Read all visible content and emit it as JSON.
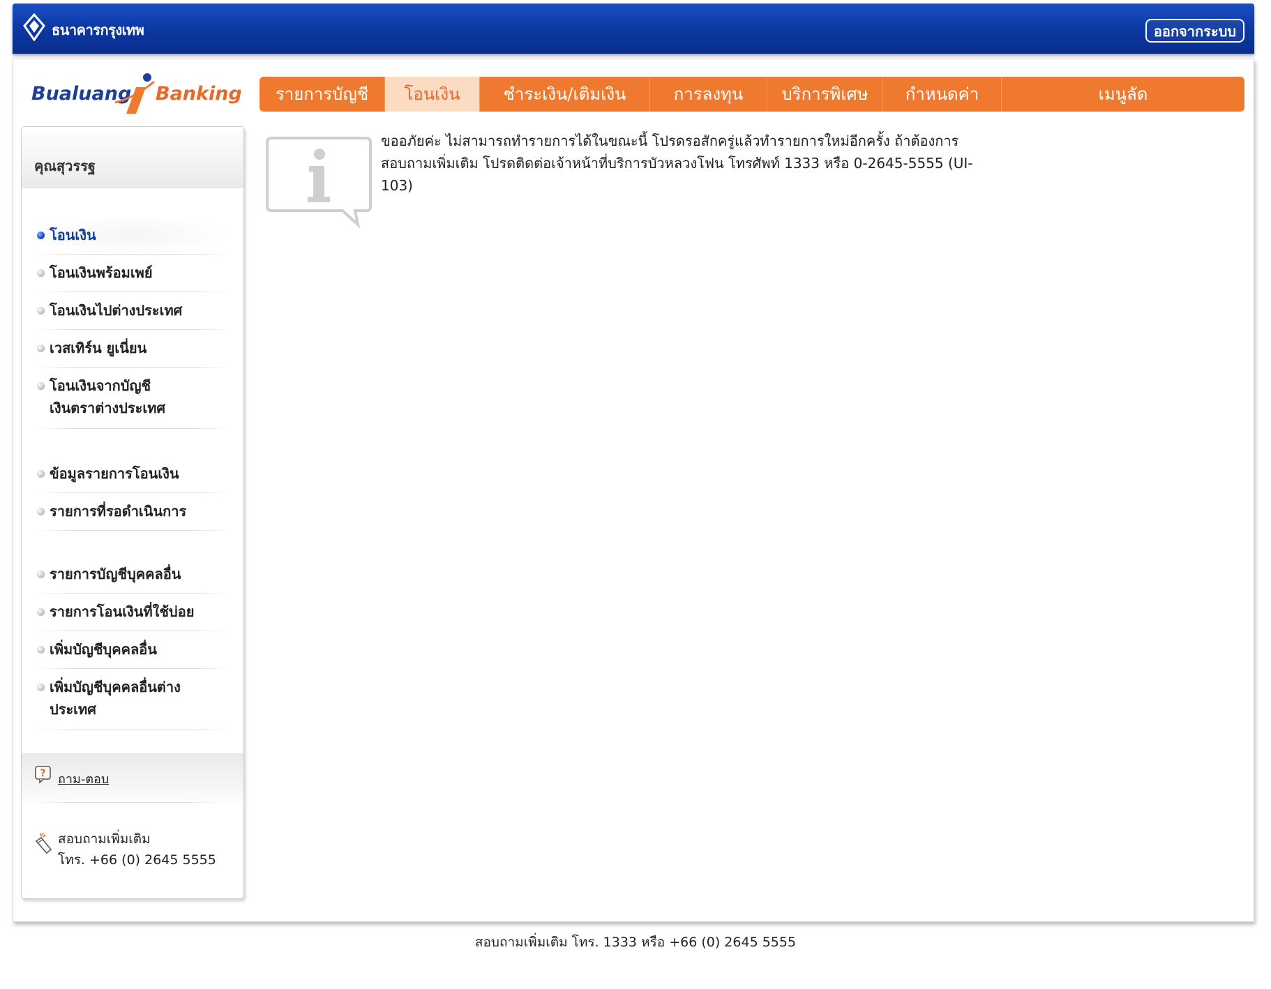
{
  "header": {
    "bank_name": "ธนาคารกรุงเทพ",
    "logout_label": "ออกจากระบบ"
  },
  "brand": {
    "logo_text_left": "Bualuang",
    "logo_text_right": "Banking",
    "logo_i": "i"
  },
  "nav": {
    "tabs": [
      {
        "label": "รายการบัญชี"
      },
      {
        "label": "โอนเงิน"
      },
      {
        "label": "ชำระเงิน/เติมเงิน"
      },
      {
        "label": "การลงทุน"
      },
      {
        "label": "บริการพิเศษ"
      },
      {
        "label": "กำหนดค่า"
      },
      {
        "label": "เมนูลัด"
      }
    ],
    "active_index": 1
  },
  "sidebar": {
    "user_name": "คุณสุวรรฐ",
    "items": [
      {
        "label": "โอนเงิน"
      },
      {
        "label": "โอนเงินพร้อมเพย์"
      },
      {
        "label": "โอนเงินไปต่างประเทศ"
      },
      {
        "label": "เวสเทิร์น ยูเนี่ยน"
      },
      {
        "label": "โอนเงินจากบัญชี"
      },
      {
        "label": "เงินตราต่างประเทศ"
      },
      {
        "label": "ข้อมูลรายการโอนเงิน"
      },
      {
        "label": "รายการที่รอดำเนินการ"
      },
      {
        "label": "รายการบัญชีบุคคลอื่น"
      },
      {
        "label": "รายการโอนเงินที่ใช้บ่อย"
      },
      {
        "label": "เพิ่มบัญชีบุคคลอื่น"
      },
      {
        "label": "เพิ่มบัญชีบุคคลอื่นต่าง"
      },
      {
        "label": "ประเทศ"
      }
    ],
    "active_item": "โอนเงิน",
    "qa_label": "ถาม-ตอบ",
    "contact_line1": "สอบถามเพิ่มเติม",
    "contact_line2": "โทร. +66 (0) 2645 5555"
  },
  "content": {
    "message_line1": "ขออภัยค่ะ ไม่สามารถทำรายการได้ในขณะนี้ โปรดรอสักครู่แล้วทำรายการใหม่อีกครั้ง ถ้าต้องการ",
    "message_line2": "สอบถามเพิ่มเติม โปรดติดต่อเจ้าหน้าที่บริการบัวหลวงโฟน โทรศัพท์ 1333 หรือ 0-2645-5555 (UI-",
    "message_line3": "103)"
  },
  "footer": {
    "text": "สอบถามเพิ่มเติม โทร. 1333 หรือ +66 (0) 2645 5555"
  },
  "colors": {
    "header_blue": "#0d3aa6",
    "nav_orange": "#ef7a2f",
    "nav_active_bg": "#fbdcc3",
    "active_menu_blue": "#0a3fa0"
  }
}
